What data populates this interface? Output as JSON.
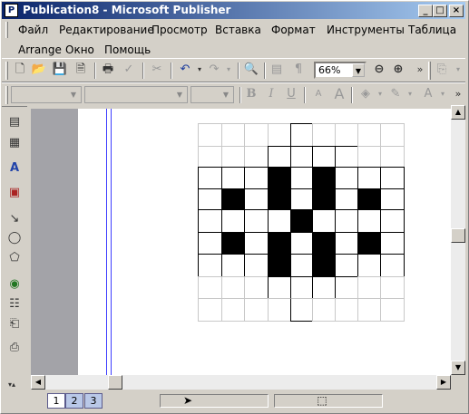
{
  "window": {
    "title": "Publication8 - Microsoft Publisher",
    "app_icon_letter": "P"
  },
  "title_buttons": {
    "minimize": "_",
    "maximize": "□",
    "close": "×"
  },
  "menu": [
    "Файл",
    "Редактирование",
    "Просмотр",
    "Вставка",
    "Формат",
    "Инструменты",
    "Таблица",
    "Arrange",
    "Окно",
    "Помощь"
  ],
  "standard_toolbar": {
    "zoom": "66%"
  },
  "status_bar": {
    "pages": [
      "1",
      "2",
      "3"
    ],
    "active_page": "1"
  },
  "grid": {
    "rows": [
      "ggggxggggg",
      "gggbbbbggg",
      "bbbBbBbbbg",
      "bBbBbBbBbg",
      "bbbbBbbbbg",
      "bBbBbBbBbg",
      "bbbBbBbbbg",
      "gggbbbbggg",
      "ggggxggggg"
    ],
    "top_border_columns": [
      4
    ],
    "bottom_border_columns": [
      4
    ]
  },
  "colors": {
    "titlebar_start": "#0a246a",
    "titlebar_end": "#a6caf0",
    "guide": "#3d3dff",
    "band": "#a3a3a8"
  }
}
